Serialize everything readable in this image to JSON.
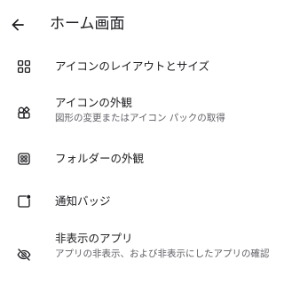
{
  "header": {
    "title": "ホーム画面",
    "back_icon": "arrow-back-icon"
  },
  "settings": {
    "items": [
      {
        "title": "アイコンのレイアウトとサイズ",
        "icon": "grid-layout-icon"
      },
      {
        "title": "アイコンの外観",
        "subtitle": "図形の変更またはアイコン パックの取得",
        "icon": "shapes-icon"
      },
      {
        "title": "フォルダーの外観",
        "icon": "folder-grid-icon"
      },
      {
        "title": "通知バッジ",
        "icon": "notification-badge-icon"
      },
      {
        "title": "非表示のアプリ",
        "subtitle": "アプリの非表示、および非表示にしたアプリの確認",
        "icon": "eye-off-icon"
      }
    ]
  },
  "colors": {
    "text_primary": "#1c1b1f",
    "text_secondary": "#5f5f66",
    "background": "#ffffff"
  }
}
